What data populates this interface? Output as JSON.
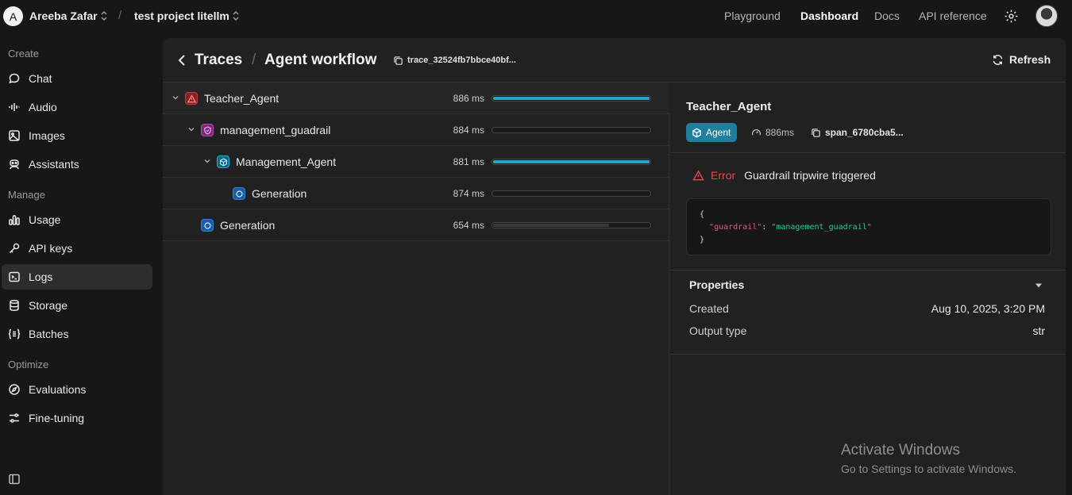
{
  "topbar": {
    "org_initial": "A",
    "org_name": "Areeba Zafar",
    "separator": "/",
    "project_name": "test project litellm",
    "nav": [
      "Playground",
      "Dashboard",
      "Docs",
      "API reference"
    ],
    "active_nav": "Dashboard"
  },
  "sidebar": {
    "sections": [
      {
        "label": "Create",
        "items": [
          {
            "label": "Chat",
            "icon": "chat-icon"
          },
          {
            "label": "Audio",
            "icon": "audio-icon"
          },
          {
            "label": "Images",
            "icon": "image-icon"
          },
          {
            "label": "Assistants",
            "icon": "assistant-icon"
          }
        ]
      },
      {
        "label": "Manage",
        "items": [
          {
            "label": "Usage",
            "icon": "usage-icon"
          },
          {
            "label": "API keys",
            "icon": "key-icon"
          },
          {
            "label": "Logs",
            "icon": "logs-icon"
          },
          {
            "label": "Storage",
            "icon": "storage-icon"
          },
          {
            "label": "Batches",
            "icon": "batches-icon"
          }
        ]
      },
      {
        "label": "Optimize",
        "items": [
          {
            "label": "Evaluations",
            "icon": "compass-icon"
          },
          {
            "label": "Fine-tuning",
            "icon": "sliders-icon"
          }
        ]
      }
    ],
    "active_item": "Logs"
  },
  "header": {
    "breadcrumb_root": "Traces",
    "breadcrumb_sep": "/",
    "title": "Agent workflow",
    "trace_id": "trace_32524fb7bbce40bf...",
    "refresh_label": "Refresh"
  },
  "tree": [
    {
      "name": "Teacher_Agent",
      "type": "error",
      "duration": "886 ms",
      "fraction": 1.0,
      "fill_color": "#22a8cc",
      "expanded": true
    },
    {
      "name": "management_guadrail",
      "type": "guardrail",
      "duration": "884 ms",
      "fraction": 0.0,
      "fill_color": "#22a8cc",
      "expanded": true
    },
    {
      "name": "Management_Agent",
      "type": "agent",
      "duration": "881 ms",
      "fraction": 1.0,
      "fill_color": "#22a8cc",
      "expanded": true
    },
    {
      "name": "Generation",
      "type": "generation",
      "duration": "874 ms",
      "fraction": 0.0,
      "fill_color": "#22a8cc"
    },
    {
      "name": "Generation",
      "type": "generation",
      "duration": "654 ms",
      "fraction": 0.74,
      "fill_color": "#3a3a3a"
    }
  ],
  "detail": {
    "title": "Teacher_Agent",
    "type_label": "Agent",
    "duration": "886ms",
    "span_id": "span_6780cba5...",
    "error_label": "Error",
    "error_message": "Guardrail tripwire triggered",
    "code": {
      "open": "{",
      "key": "\"guardrail\"",
      "colon": ": ",
      "value": "\"management_guadrail\"",
      "close": "}"
    },
    "properties_title": "Properties",
    "properties": [
      {
        "key": "Created",
        "value": "Aug 10, 2025, 3:20 PM"
      },
      {
        "key": "Output type",
        "value": "str"
      }
    ]
  },
  "watermark": {
    "line1": "Activate Windows",
    "line2": "Go to Settings to activate Windows."
  },
  "colors": {
    "accent": "#22a8cc",
    "error": "#e5484d",
    "guardrail": "#b54ab3",
    "agent": "#1f7f9c",
    "generation": "#2d7fd3"
  }
}
